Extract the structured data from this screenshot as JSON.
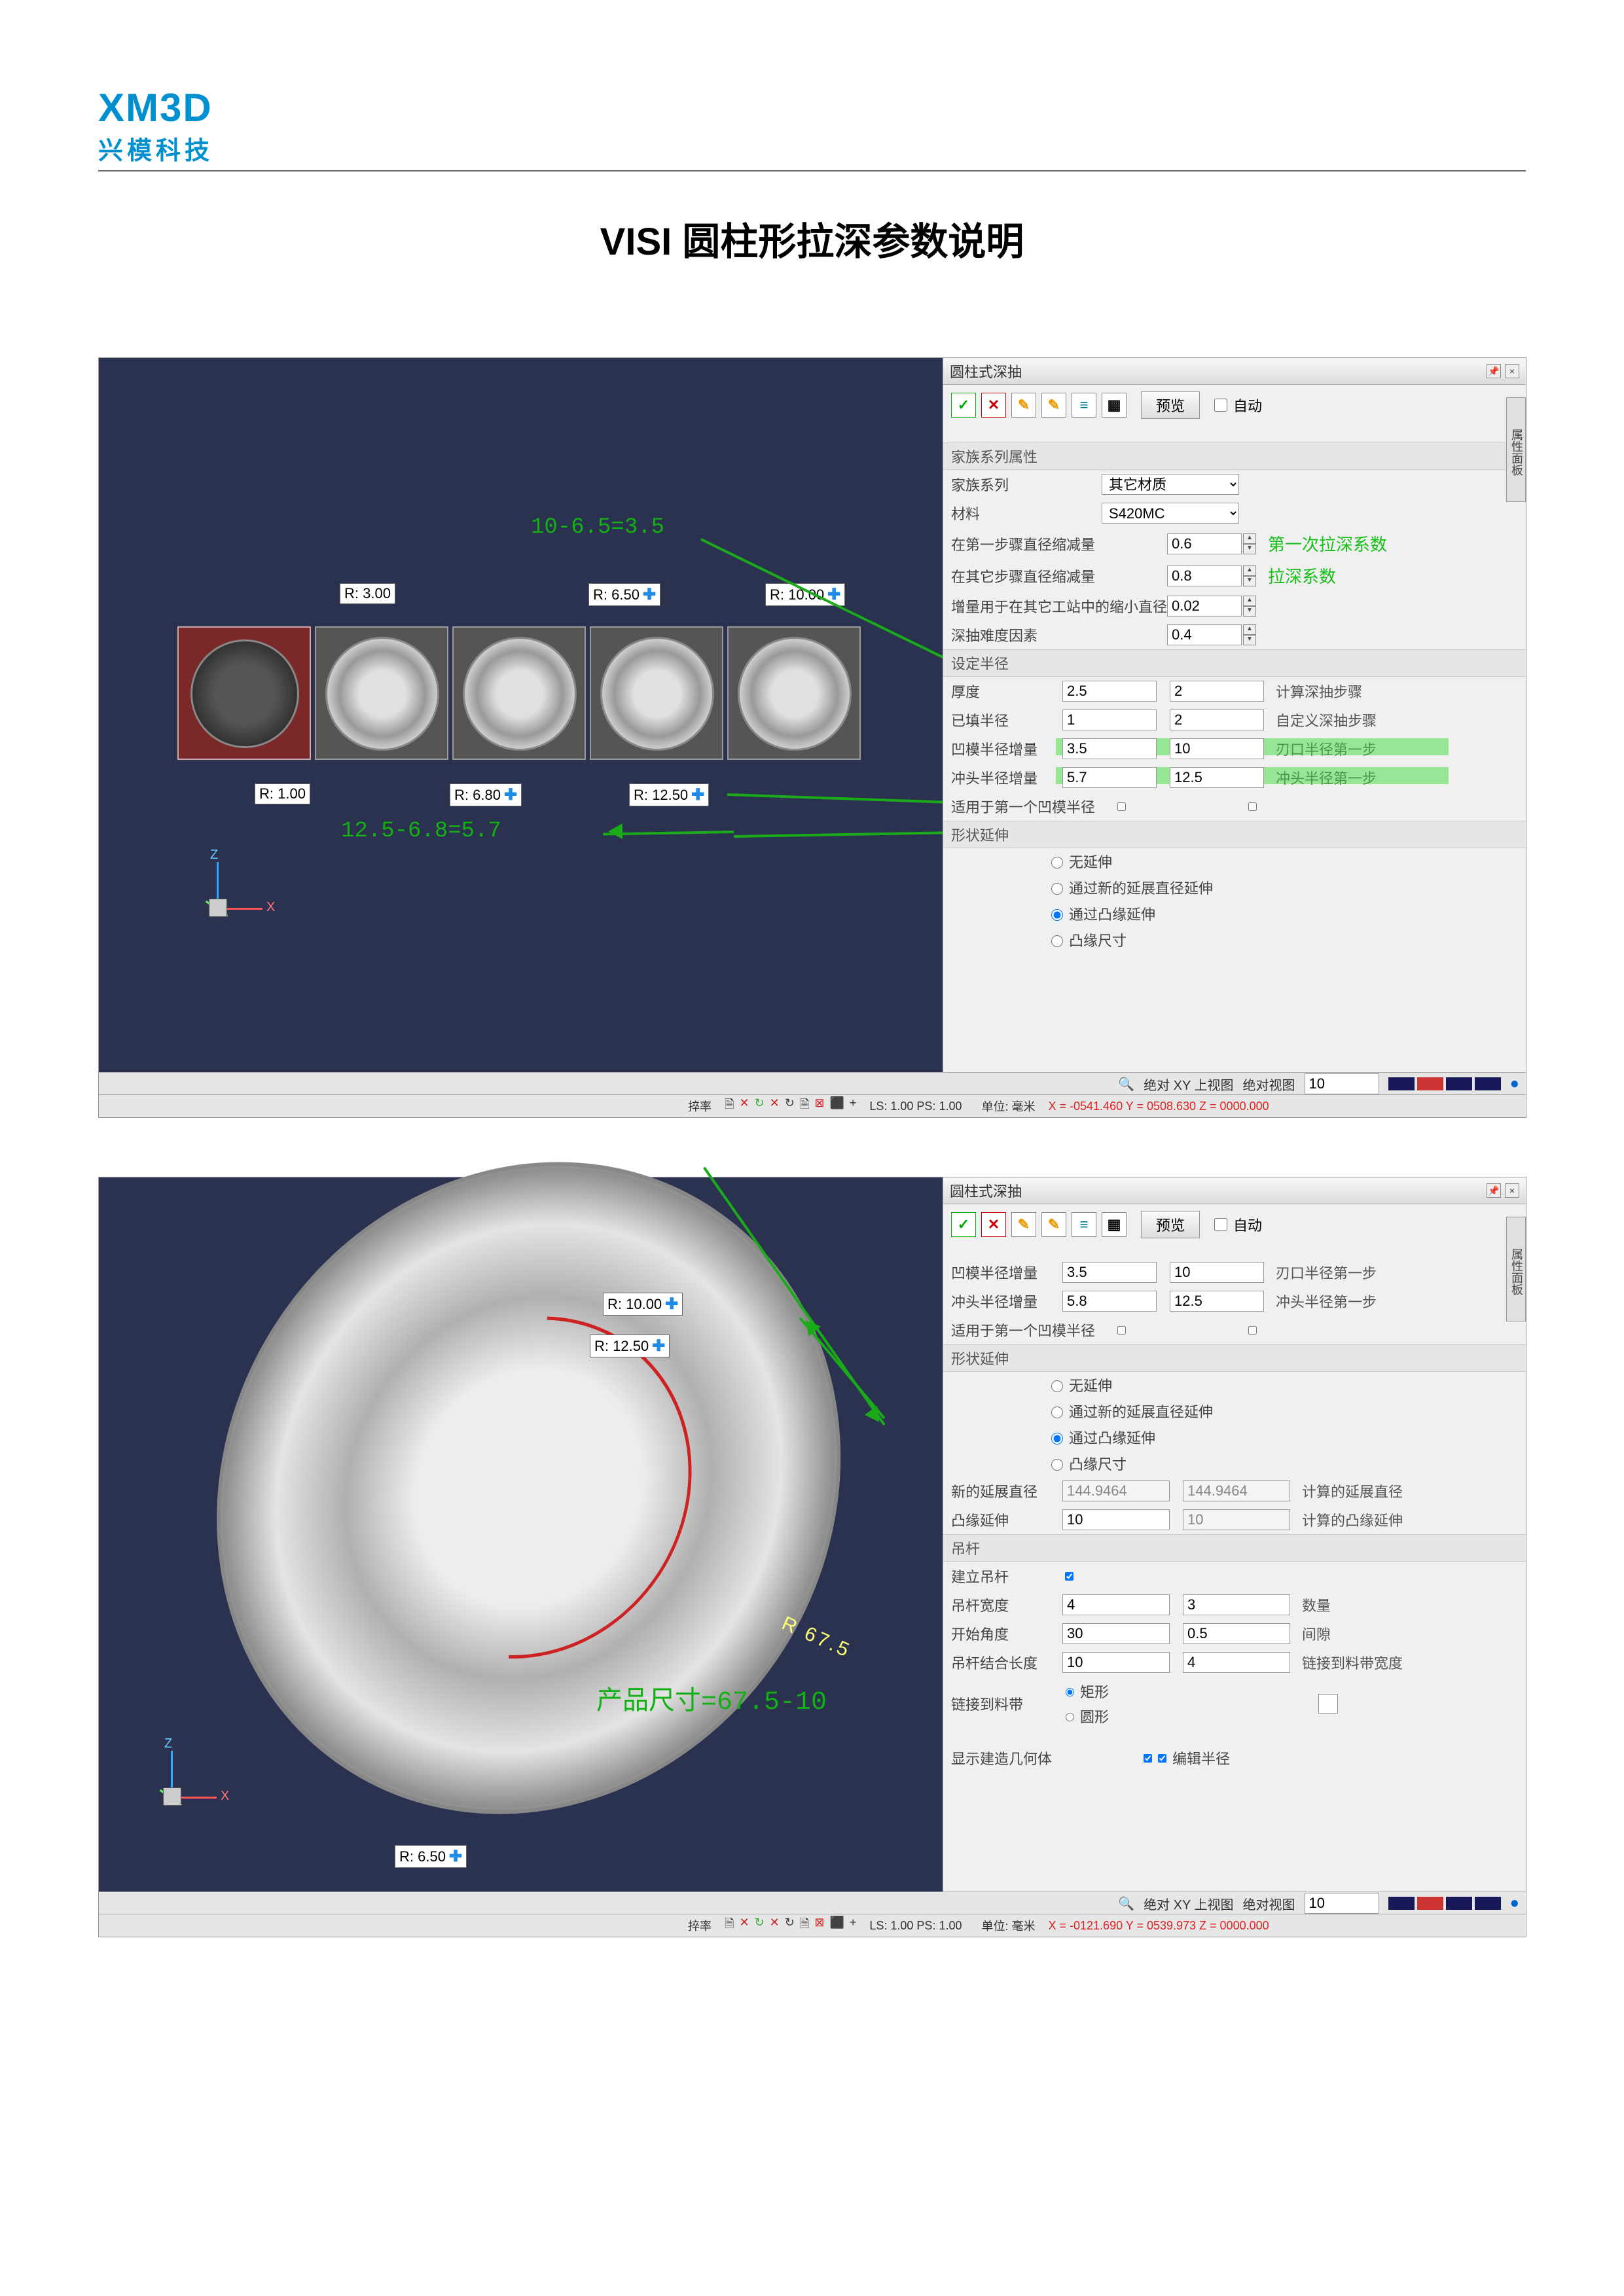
{
  "logo": {
    "line1": "XM3D",
    "line2": "兴模科技"
  },
  "doc_title": "VISI 圆柱形拉深参数说明",
  "shot1": {
    "panel_title": "圆柱式深抽",
    "toolbar": {
      "preview": "预览",
      "auto": "自动"
    },
    "sec_props": "家族系列属性",
    "family_label": "家族系列",
    "family_value": "其它材质",
    "material_label": "材料",
    "material_value": "S420MC",
    "r1_lab": "在第一步骤直径缩减量",
    "r1_val": "0.6",
    "r2_lab": "在其它步骤直径缩减量",
    "r2_val": "0.8",
    "r3_lab": "增量用于在其它工站中的缩小直径",
    "r3_val": "0.02",
    "r4_lab": "深抽难度因素",
    "r4_val": "0.4",
    "note_first": "第一次拉深系数",
    "note_deep": "拉深系数",
    "sec_radius": "设定半径",
    "thk_lab": "厚度",
    "thk_a": "2.5",
    "thk_b": "2",
    "thk_r": "计算深抽步骤",
    "fil_lab": "已填半径",
    "fil_a": "1",
    "fil_b": "2",
    "fil_r": "自定义深抽步骤",
    "die_lab": "凹模半径增量",
    "die_a": "3.5",
    "die_b": "10",
    "die_r": "刃口半径第一步",
    "pun_lab": "冲头半径增量",
    "pun_a": "5.7",
    "pun_b": "12.5",
    "pun_r": "冲头半径第一步",
    "apply_lab": "适用于第一个凹模半径",
    "sec_ext": "形状延伸",
    "rad_none": "无延伸",
    "rad_new": "通过新的延展直径延伸",
    "rad_flange": "通过凸缘延伸",
    "rad_size": "凸缘尺寸",
    "tags": {
      "r300": "R: 3.00",
      "r650": "R: 6.50",
      "r1000": "R: 10.00",
      "r100": "R: 1.00",
      "r680": "R: 6.80",
      "r1250": "R: 12.50"
    },
    "ann_a": "10-6.5=3.5",
    "ann_b": "12.5-6.8=5.7",
    "sb2": {
      "abs": "绝对 XY 上视图",
      "view": "绝对视图",
      "num": "10"
    },
    "sb": {
      "lock": "捽率",
      "ls": "LS: 1.00 PS: 1.00",
      "unit": "单位: 毫米",
      "coords": "X = -0541.460 Y = 0508.630 Z = 0000.000"
    }
  },
  "shot2": {
    "panel_title": "圆柱式深抽",
    "toolbar": {
      "preview": "预览",
      "auto": "自动"
    },
    "die_lab": "凹模半径增量",
    "die_a": "3.5",
    "die_b": "10",
    "die_r": "刃口半径第一步",
    "pun_lab": "冲头半径增量",
    "pun_a": "5.8",
    "pun_b": "12.5",
    "pun_r": "冲头半径第一步",
    "apply_lab": "适用于第一个凹模半径",
    "sec_ext": "形状延伸",
    "rad_none": "无延伸",
    "rad_new": "通过新的延展直径延伸",
    "rad_flange": "通过凸缘延伸",
    "rad_size": "凸缘尺寸",
    "newd_lab": "新的延展直径",
    "newd_a": "144.9464",
    "newd_b": "144.9464",
    "newd_r": "计算的延展直径",
    "fl_lab": "凸缘延伸",
    "fl_a": "10",
    "fl_b": "10",
    "fl_r": "计算的凸缘延伸",
    "sec_hang": "吊杆",
    "build_lab": "建立吊杆",
    "wid_lab": "吊杆宽度",
    "wid_a": "4",
    "wid_b": "3",
    "wid_r": "数量",
    "ang_lab": "开始角度",
    "ang_a": "30",
    "ang_b": "0.5",
    "ang_r": "间隙",
    "len_lab": "吊杆结合长度",
    "len_a": "10",
    "len_b": "4",
    "len_r": "链接到料带宽度",
    "link_lab": "链接到料带",
    "link_rect": "矩形",
    "link_circ": "圆形",
    "show_lab": "显示建造几何体",
    "edit_r": "编辑半径",
    "tags": {
      "r1000": "R: 10.00",
      "r1250": "R: 12.50",
      "r650": "R: 6.50"
    },
    "ann_r": "R 67.5",
    "ann_eq": "产品尺寸=67.5-10",
    "sb2": {
      "abs": "绝对 XY 上视图",
      "view": "绝对视图",
      "num": "10"
    },
    "sb": {
      "ls": "LS: 1.00 PS: 1.00",
      "unit": "单位: 毫米",
      "coords": "X = -0121.690 Y = 0539.973 Z = 0000.000"
    }
  }
}
